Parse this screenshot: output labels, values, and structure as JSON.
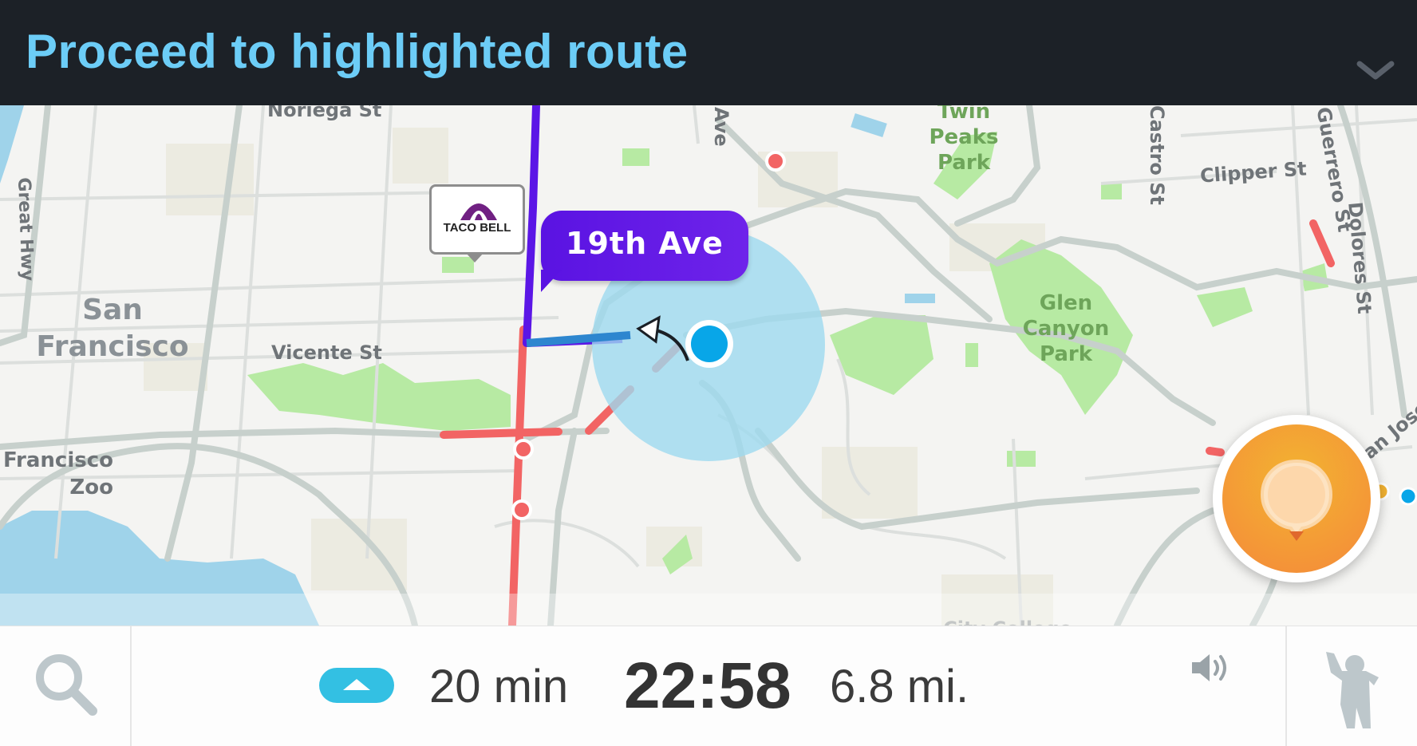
{
  "instruction_bar": {
    "text": "Proceed to highlighted route",
    "collapse_icon": "chevron-down-icon"
  },
  "map": {
    "street_labels": [
      "Noriega St",
      "Vicente St",
      "Great Hwy",
      "Clipper St",
      "Dolores St",
      "San Jose Ave",
      "Castro St",
      "Guerrero St",
      "Ave"
    ],
    "park_labels": [
      "Twin Peaks Park",
      "Glen Canyon Park"
    ],
    "area_labels": [
      "San Francisco",
      "San Francisco Zoo",
      "City College of SF"
    ],
    "poi": {
      "brand": "TACO BELL",
      "icon": "taco-bell-logo"
    },
    "current_street": "19th Ave",
    "route_color": "#5b16e6",
    "traffic_color": "#f26464",
    "position_color": "#08a6e8"
  },
  "report_button": {
    "icon": "report-pin-icon",
    "color": "#f59a36"
  },
  "bottom_bar": {
    "search_icon": "search-icon",
    "eta_icon": "eta-arrow-icon",
    "duration": "20 min",
    "arrival_time": "22:58",
    "distance": "6.8 mi.",
    "sound_icon": "speaker-icon",
    "profile_icon": "wazer-icon"
  }
}
